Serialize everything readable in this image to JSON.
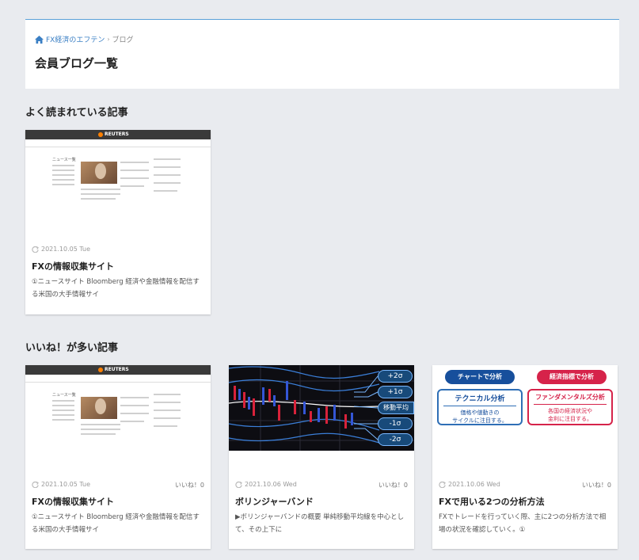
{
  "breadcrumb": {
    "home": "FX経済のエフテン",
    "current": "ブログ"
  },
  "page_title": "会員ブログ一覧",
  "sections": {
    "popular": {
      "title": "よく読まれている記事",
      "cards": [
        {
          "date": "2021.10.05 Tue",
          "title": "FXの情報収集サイト",
          "excerpt": "①ニュースサイト Bloomberg 経済や金融情報を配信する米国の大手情報サイ"
        }
      ]
    },
    "liked": {
      "title": "いいね！が多い記事",
      "cards": [
        {
          "date": "2021.10.05 Tue",
          "likes": "いいね！0",
          "title": "FXの情報収集サイト",
          "excerpt": "①ニュースサイト Bloomberg 経済や金融情報を配信する米国の大手情報サイ"
        },
        {
          "date": "2021.10.06 Wed",
          "likes": "いいね！0",
          "title": "ボリンジャーバンド",
          "excerpt": "▶ボリンジャーバンドの概要 単純移動平均線を中心として、その上下に"
        },
        {
          "date": "2021.10.06 Wed",
          "likes": "いいね！0",
          "title": "FXで用いる2つの分析方法",
          "excerpt": "FXでトレードを行っていく際、主に2つの分析方法で相場の状況を確認していく。①"
        }
      ]
    }
  },
  "thumbnails": {
    "reuters": {
      "brand": "REUTERS",
      "photo_caption": "ニュース一覧"
    },
    "bollinger": {
      "labels": [
        "+2σ",
        "+1σ",
        "移動平均",
        "-1σ",
        "-2σ"
      ]
    },
    "analysis": {
      "left_tag": "チャートで分析",
      "right_tag": "経済指標で分析",
      "left_title": "テクニカル分析",
      "left_text": "価格や値動きの\nサイクルに注目する。",
      "right_title": "ファンダメンタルズ分析",
      "right_text": "各国の経済状況や\n金利に注目する。"
    }
  },
  "colors": {
    "accent_blue": "#3a7fc4",
    "tag_blue": "#174f9c",
    "tag_red": "#d6234a"
  },
  "icons": {
    "home": "home-icon",
    "refresh": "refresh-icon"
  }
}
